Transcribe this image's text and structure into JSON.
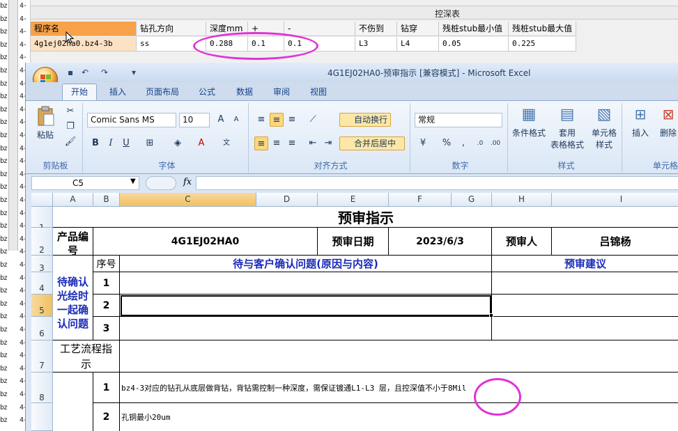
{
  "bg_strip": {
    "glyph_col_a": [
      "bz",
      "bz",
      "bz",
      "bz",
      "bz",
      "bz",
      "bz",
      "bz",
      "bz",
      "bz",
      "bz",
      "bz",
      "bz",
      "bz",
      "bz",
      "bz",
      "bz",
      "bz",
      "bz",
      "bz",
      "bz",
      "bz",
      "bz",
      "bz",
      "bz",
      "bz",
      "bz",
      "bz",
      "bz",
      "bz",
      "bz",
      "bz",
      "bz"
    ],
    "glyph_col_b": [
      "4-",
      "4-",
      "4-",
      "4-",
      "4-",
      "4-",
      "4-",
      "4-",
      "4-",
      "4-",
      "4-",
      "4-",
      "4-",
      "4-",
      "4-",
      "4-",
      "4-",
      "4-",
      "4-",
      "4-",
      "4-",
      "4-",
      "4-",
      "4-",
      "4-",
      "4-",
      "4-",
      "4-",
      "4-",
      "4-",
      "4-",
      "4-",
      "4-"
    ]
  },
  "top_grid": {
    "caption": "控深表",
    "headers": [
      "程序名",
      "钻孔方向",
      "深度mm",
      "+",
      "-",
      "不伤到",
      "钻穿",
      "残桩stub最小值",
      "残桩stub最大值"
    ],
    "row": [
      "4g1ej02ha0.bz4-3b",
      "ss",
      "0.288",
      "0.1",
      "0.1",
      "L3",
      "L4",
      "0.05",
      "0.225"
    ]
  },
  "excel": {
    "title": "4G1EJ02HA0-预审指示  [兼容模式] - Microsoft Excel",
    "tabs": [
      "开始",
      "插入",
      "页面布局",
      "公式",
      "数据",
      "审阅",
      "视图"
    ],
    "groups": {
      "clipboard": "剪贴板",
      "font": "字体",
      "alignment": "对齐方式",
      "number": "数字",
      "styles": "样式",
      "cells": "单元格"
    },
    "paste": "粘贴",
    "font_name": "Comic Sans MS",
    "font_size": "10",
    "wrap_text": "自动换行",
    "merge_center": "合并后居中",
    "number_format": "常规",
    "cond_format": "条件格式",
    "table_format_1": "套用",
    "table_format_2": "表格格式",
    "cell_styles_1": "单元格",
    "cell_styles_2": "样式",
    "insert": "插入",
    "delete": "删除",
    "name_box": "C5",
    "fx": "fx",
    "columns": [
      "A",
      "B",
      "C",
      "D",
      "E",
      "F",
      "G",
      "H",
      "I"
    ],
    "rows": [
      "1",
      "2",
      "3",
      "4",
      "5",
      "6",
      "7",
      "8",
      ""
    ]
  },
  "sheet": {
    "title": "预审指示",
    "product_label": "产品编号",
    "product_no": "4G1EJ02HA0",
    "review_date_label": "预审日期",
    "review_date": "2023/6/3",
    "reviewer_label": "预审人",
    "reviewer": "吕锦杨",
    "seq_label": "序号",
    "issues_label": "待与客户确认问题(原因与内容)",
    "suggest_label": "预审建议",
    "pending_label": "待确认光绘时一起确认问题",
    "seq": [
      "1",
      "2",
      "3"
    ],
    "process_label": "工艺流程指示",
    "proc_seq_1": "1",
    "proc_text_1": "bz4-3对应的钻孔从底层做背钻，背钻需控制一种深度，需保证镀通L1-L3 层，且控深值不小于8Mil",
    "proc_seq_2": "2",
    "proc_text_2": "孔铜最小20um"
  },
  "colors": {
    "highlight_ellipse": "#e033d6",
    "header_orange": "#f7a24a",
    "ribbon_text": "#15428b",
    "blue_text": "#1a2bb8"
  }
}
